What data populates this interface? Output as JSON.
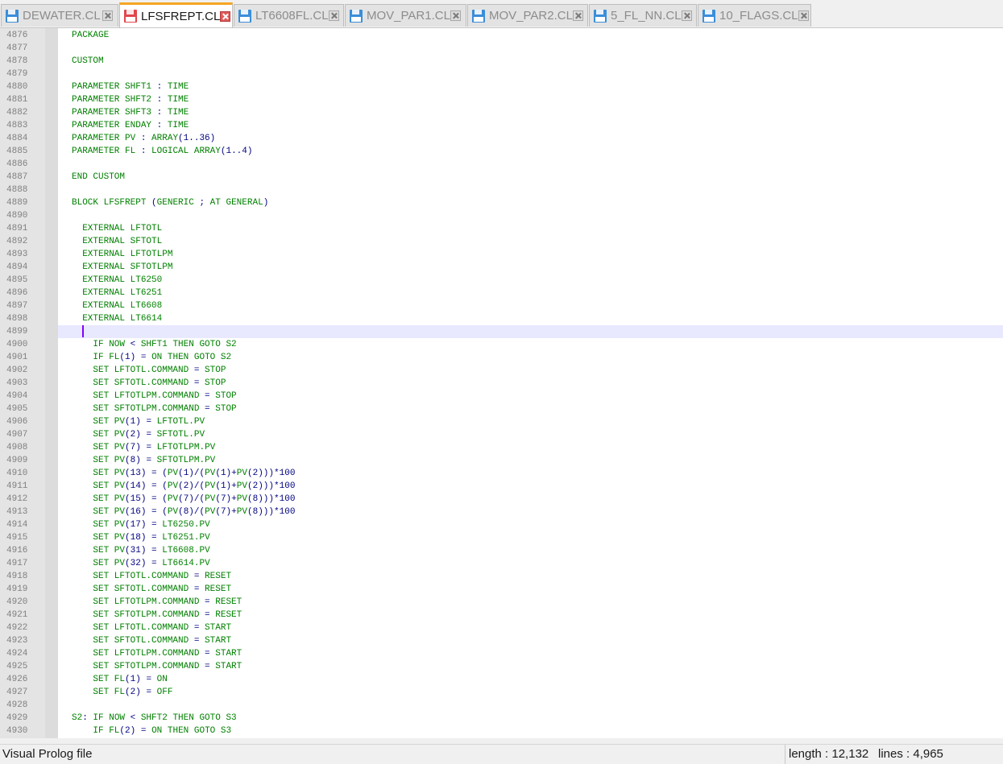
{
  "tabs": [
    {
      "label": "DEWATER.CL",
      "active": false
    },
    {
      "label": "LFSFREPT.CL",
      "active": true
    },
    {
      "label": "LT6608FL.CL",
      "active": false
    },
    {
      "label": "MOV_PAR1.CL",
      "active": false
    },
    {
      "label": "MOV_PAR2.CL",
      "active": false
    },
    {
      "label": "5_FL_NN.CL",
      "active": false
    },
    {
      "label": "10_FLAGS.CL",
      "active": false
    }
  ],
  "colors": {
    "code_text": "#008000",
    "operator": "#000080",
    "line_number": "#808080",
    "caret_line": "#e8e8ff",
    "caret": "#8000ff",
    "active_tab_accent": "#f5a623"
  },
  "editor": {
    "caret_line_number": "4899",
    "lines": [
      {
        "n": "4876",
        "t": "PACKAGE"
      },
      {
        "n": "4877",
        "t": ""
      },
      {
        "n": "4878",
        "t": "CUSTOM"
      },
      {
        "n": "4879",
        "t": ""
      },
      {
        "n": "4880",
        "t": "PARAMETER SHFT1 : TIME"
      },
      {
        "n": "4881",
        "t": "PARAMETER SHFT2 : TIME"
      },
      {
        "n": "4882",
        "t": "PARAMETER SHFT3 : TIME"
      },
      {
        "n": "4883",
        "t": "PARAMETER ENDAY : TIME"
      },
      {
        "n": "4884",
        "t": "PARAMETER PV : ARRAY(1..36)"
      },
      {
        "n": "4885",
        "t": "PARAMETER FL : LOGICAL ARRAY(1..4)"
      },
      {
        "n": "4886",
        "t": ""
      },
      {
        "n": "4887",
        "t": "END CUSTOM"
      },
      {
        "n": "4888",
        "t": ""
      },
      {
        "n": "4889",
        "t": "BLOCK LFSFREPT (GENERIC ; AT GENERAL)"
      },
      {
        "n": "4890",
        "t": ""
      },
      {
        "n": "4891",
        "t": "  EXTERNAL LFTOTL"
      },
      {
        "n": "4892",
        "t": "  EXTERNAL SFTOTL"
      },
      {
        "n": "4893",
        "t": "  EXTERNAL LFTOTLPM"
      },
      {
        "n": "4894",
        "t": "  EXTERNAL SFTOTLPM"
      },
      {
        "n": "4895",
        "t": "  EXTERNAL LT6250"
      },
      {
        "n": "4896",
        "t": "  EXTERNAL LT6251"
      },
      {
        "n": "4897",
        "t": "  EXTERNAL LT6608"
      },
      {
        "n": "4898",
        "t": "  EXTERNAL LT6614"
      },
      {
        "n": "4899",
        "t": ""
      },
      {
        "n": "4900",
        "t": "    IF NOW < SHFT1 THEN GOTO S2"
      },
      {
        "n": "4901",
        "t": "    IF FL(1) = ON THEN GOTO S2"
      },
      {
        "n": "4902",
        "t": "    SET LFTOTL.COMMAND = STOP"
      },
      {
        "n": "4903",
        "t": "    SET SFTOTL.COMMAND = STOP"
      },
      {
        "n": "4904",
        "t": "    SET LFTOTLPM.COMMAND = STOP"
      },
      {
        "n": "4905",
        "t": "    SET SFTOTLPM.COMMAND = STOP"
      },
      {
        "n": "4906",
        "t": "    SET PV(1) = LFTOTL.PV"
      },
      {
        "n": "4907",
        "t": "    SET PV(2) = SFTOTL.PV"
      },
      {
        "n": "4908",
        "t": "    SET PV(7) = LFTOTLPM.PV"
      },
      {
        "n": "4909",
        "t": "    SET PV(8) = SFTOTLPM.PV"
      },
      {
        "n": "4910",
        "t": "    SET PV(13) = (PV(1)/(PV(1)+PV(2)))*100"
      },
      {
        "n": "4911",
        "t": "    SET PV(14) = (PV(2)/(PV(1)+PV(2)))*100"
      },
      {
        "n": "4912",
        "t": "    SET PV(15) = (PV(7)/(PV(7)+PV(8)))*100"
      },
      {
        "n": "4913",
        "t": "    SET PV(16) = (PV(8)/(PV(7)+PV(8)))*100"
      },
      {
        "n": "4914",
        "t": "    SET PV(17) = LT6250.PV"
      },
      {
        "n": "4915",
        "t": "    SET PV(18) = LT6251.PV"
      },
      {
        "n": "4916",
        "t": "    SET PV(31) = LT6608.PV"
      },
      {
        "n": "4917",
        "t": "    SET PV(32) = LT6614.PV"
      },
      {
        "n": "4918",
        "t": "    SET LFTOTL.COMMAND = RESET"
      },
      {
        "n": "4919",
        "t": "    SET SFTOTL.COMMAND = RESET"
      },
      {
        "n": "4920",
        "t": "    SET LFTOTLPM.COMMAND = RESET"
      },
      {
        "n": "4921",
        "t": "    SET SFTOTLPM.COMMAND = RESET"
      },
      {
        "n": "4922",
        "t": "    SET LFTOTL.COMMAND = START"
      },
      {
        "n": "4923",
        "t": "    SET SFTOTL.COMMAND = START"
      },
      {
        "n": "4924",
        "t": "    SET LFTOTLPM.COMMAND = START"
      },
      {
        "n": "4925",
        "t": "    SET SFTOTLPM.COMMAND = START"
      },
      {
        "n": "4926",
        "t": "    SET FL(1) = ON"
      },
      {
        "n": "4927",
        "t": "    SET FL(2) = OFF"
      },
      {
        "n": "4928",
        "t": ""
      },
      {
        "n": "4929",
        "t": "S2: IF NOW < SHFT2 THEN GOTO S3"
      },
      {
        "n": "4930",
        "t": "    IF FL(2) = ON THEN GOTO S3"
      }
    ]
  },
  "statusbar": {
    "file_type": "Visual Prolog file",
    "length": "length : 12,132",
    "lines": "lines : 4,965"
  }
}
